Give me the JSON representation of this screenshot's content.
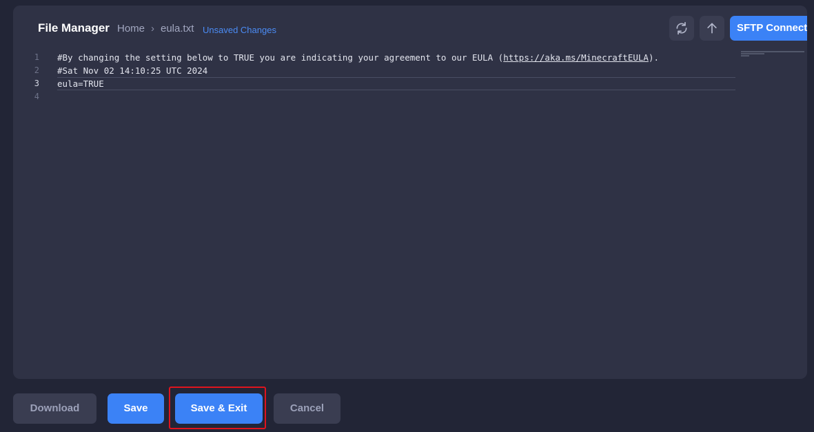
{
  "header": {
    "title": "File Manager",
    "breadcrumb": {
      "home": "Home",
      "separator": "›",
      "file": "eula.txt"
    },
    "unsaved_label": "Unsaved Changes",
    "refresh_icon": "refresh-icon",
    "upload_icon": "upload-arrow-icon",
    "sftp_label": "SFTP Connect"
  },
  "editor": {
    "active_line": 3,
    "lines": [
      {
        "num": "1",
        "text_before": "#By changing the setting below to TRUE you are indicating your agreement to our EULA (",
        "link": "https://aka.ms/MinecraftEULA",
        "text_after": ")."
      },
      {
        "num": "2",
        "text": "#Sat Nov 02 14:10:25 UTC 2024"
      },
      {
        "num": "3",
        "text": "eula=TRUE"
      },
      {
        "num": "4",
        "text": ""
      }
    ]
  },
  "footer": {
    "download_label": "Download",
    "save_label": "Save",
    "save_exit_label": "Save & Exit",
    "cancel_label": "Cancel"
  },
  "colors": {
    "accent": "#3b82f6",
    "unsaved": "#4b8cf5",
    "highlight": "#e0141e",
    "panel_bg": "#2f3245",
    "page_bg": "#222536"
  }
}
